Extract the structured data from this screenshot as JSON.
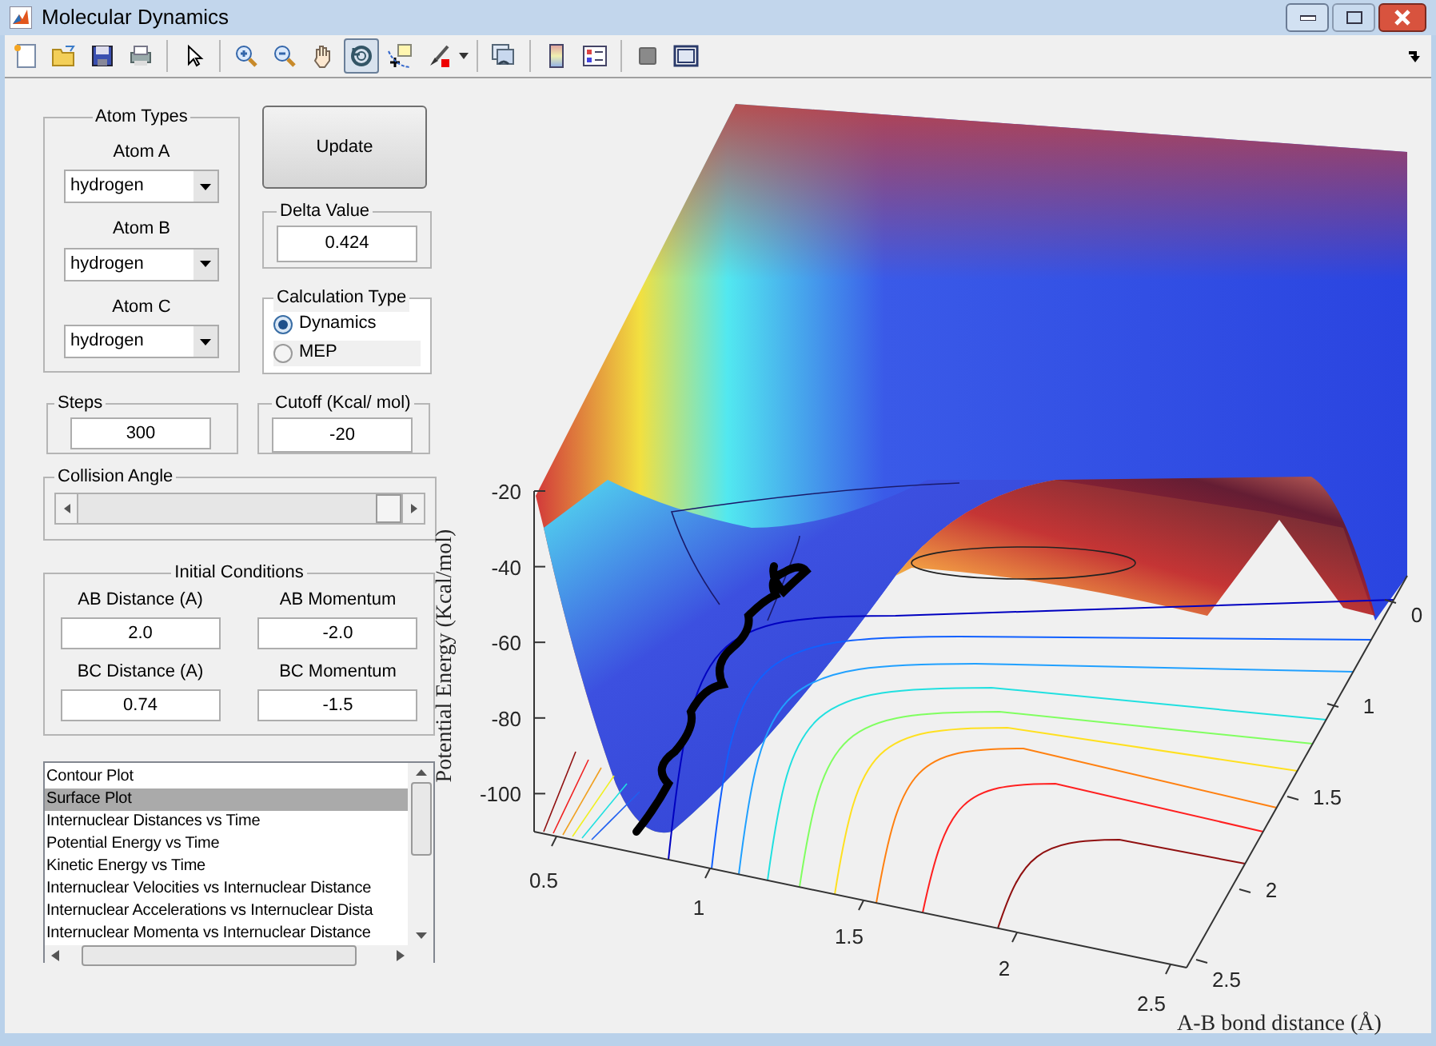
{
  "window": {
    "title": "Molecular Dynamics"
  },
  "toolbar": [
    {
      "kind": "new",
      "selected": false
    },
    {
      "kind": "open",
      "selected": false
    },
    {
      "kind": "save",
      "selected": false
    },
    {
      "kind": "print",
      "selected": false
    },
    {
      "kind": "sep"
    },
    {
      "kind": "pointer",
      "selected": false
    },
    {
      "kind": "sep"
    },
    {
      "kind": "zoom-in",
      "selected": false
    },
    {
      "kind": "zoom-out",
      "selected": false
    },
    {
      "kind": "pan",
      "selected": false
    },
    {
      "kind": "rotate",
      "selected": true
    },
    {
      "kind": "data-cursor",
      "selected": false
    },
    {
      "kind": "brush",
      "selected": false
    },
    {
      "kind": "caret"
    },
    {
      "kind": "sep"
    },
    {
      "kind": "link",
      "selected": false
    },
    {
      "kind": "sep"
    },
    {
      "kind": "colorbar",
      "selected": false
    },
    {
      "kind": "legend",
      "selected": false
    },
    {
      "kind": "sep"
    },
    {
      "kind": "hide",
      "selected": false
    },
    {
      "kind": "frame",
      "selected": false
    }
  ],
  "atom_types": {
    "title": "Atom Types",
    "atoms": [
      {
        "label": "Atom A",
        "value": "hydrogen"
      },
      {
        "label": "Atom B",
        "value": "hydrogen"
      },
      {
        "label": "Atom C",
        "value": "hydrogen"
      }
    ]
  },
  "update_button": "Update",
  "delta_value": {
    "title": "Delta Value",
    "value": "0.424"
  },
  "calculation_type": {
    "title": "Calculation Type",
    "options": [
      {
        "label": "Dynamics",
        "selected": true
      },
      {
        "label": "MEP",
        "selected": false
      }
    ]
  },
  "steps": {
    "title": "Steps",
    "value": "300"
  },
  "cutoff": {
    "title": "Cutoff (Kcal/ mol)",
    "value": "-20"
  },
  "collision_angle": {
    "title": "Collision Angle",
    "level": 1
  },
  "initial_conditions": {
    "title": "Initial Conditions",
    "fields": [
      {
        "label": "AB Distance (A)",
        "value": "2.0"
      },
      {
        "label": "AB Momentum",
        "value": "-2.0"
      },
      {
        "label": "BC Distance (A)",
        "value": "0.74"
      },
      {
        "label": "BC Momentum",
        "value": "-1.5"
      }
    ]
  },
  "plot_list": [
    {
      "label": "Contour Plot",
      "selected": false
    },
    {
      "label": "Surface Plot",
      "selected": true
    },
    {
      "label": "Internuclear Distances vs Time",
      "selected": false
    },
    {
      "label": "Potential Energy vs Time",
      "selected": false
    },
    {
      "label": "Kinetic Energy vs Time",
      "selected": false
    },
    {
      "label": "Internuclear Velocities vs Internuclear Distance",
      "selected": false
    },
    {
      "label": "Internuclear Accelerations vs Internuclear Dista",
      "selected": false
    },
    {
      "label": "Internuclear Momenta vs Internuclear Distance",
      "selected": false
    }
  ],
  "plot": {
    "z_label": "Potential Energy (Kcal/mol)",
    "x_label": "A-B bond distance (Å)",
    "z_ticks": [
      "-20",
      "-40",
      "-60",
      "-80",
      "-100"
    ],
    "x_ticks": [
      "0.5",
      "1",
      "1.5",
      "2",
      "2.5"
    ],
    "y_ticks": [
      "0",
      "1",
      "1.5",
      "2",
      "2.5"
    ]
  }
}
